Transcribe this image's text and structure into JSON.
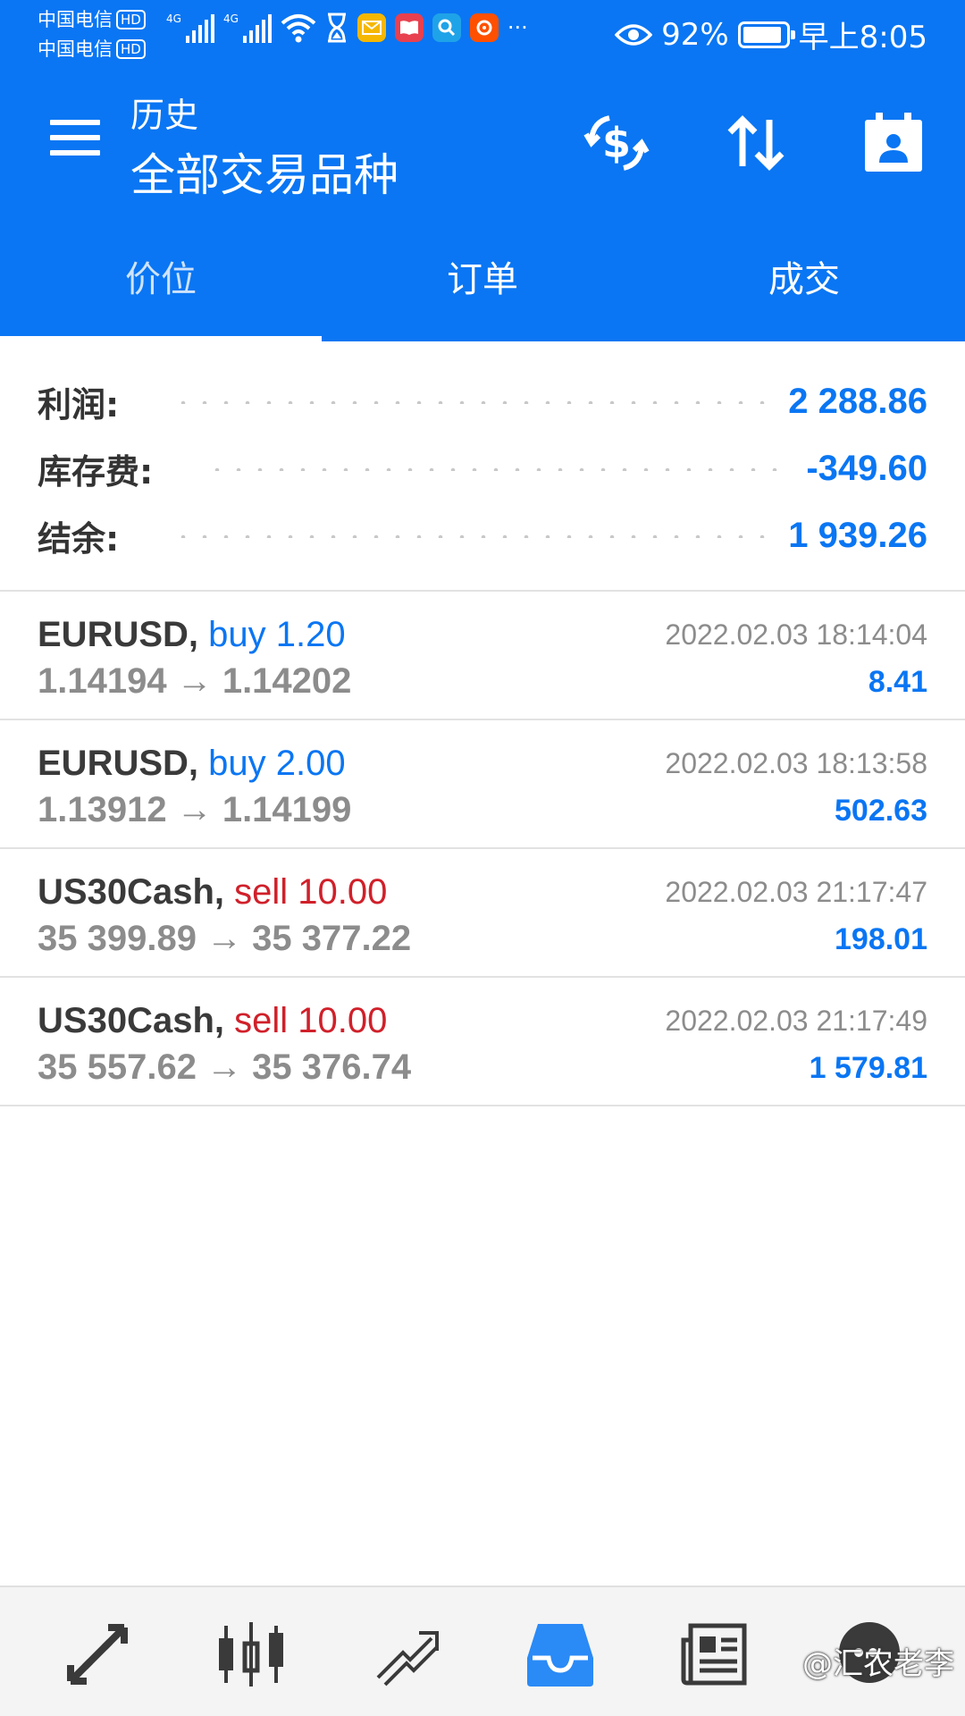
{
  "status_bar": {
    "carrier_1": "中国电信",
    "carrier_2": "中国电信",
    "hd_badge": "HD",
    "network_1": "4G",
    "network_2": "4G",
    "more": "···",
    "battery_percent": "92%",
    "battery_level": 0.92,
    "time": "早上8:05"
  },
  "toolbar": {
    "subtitle": "历史",
    "title": "全部交易品种"
  },
  "tabs": [
    {
      "label": "价位",
      "active": true
    },
    {
      "label": "订单",
      "active": false
    },
    {
      "label": "成交",
      "active": false
    }
  ],
  "summary": {
    "profit": {
      "label": "利润:",
      "value": "2 288.86"
    },
    "swap": {
      "label": "库存费:",
      "value": "-349.60"
    },
    "balance": {
      "label": "结余:",
      "value": "1 939.26"
    }
  },
  "deals": [
    {
      "symbol": "EURUSD,",
      "side": "buy",
      "side_text": "buy 1.20",
      "prices": "1.14194 → 1.14202",
      "time": "2022.02.03 18:14:04",
      "profit": "8.41"
    },
    {
      "symbol": "EURUSD,",
      "side": "buy",
      "side_text": "buy 2.00",
      "prices": "1.13912 → 1.14199",
      "time": "2022.02.03 18:13:58",
      "profit": "502.63"
    },
    {
      "symbol": "US30Cash,",
      "side": "sell",
      "side_text": "sell 10.00",
      "prices": "35 399.89 → 35 377.22",
      "time": "2022.02.03 21:17:47",
      "profit": "198.01"
    },
    {
      "symbol": "US30Cash,",
      "side": "sell",
      "side_text": "sell 10.00",
      "prices": "35 557.62 → 35 376.74",
      "time": "2022.02.03 21:17:49",
      "profit": "1 579.81"
    }
  ],
  "bottom_nav": {
    "items": [
      "quotes-icon",
      "chart-icon",
      "trade-icon",
      "history-icon",
      "news-icon",
      "chat-icon"
    ],
    "active": "history-icon"
  },
  "watermark": "@汇农老李",
  "colors": {
    "brand_blue": "#0a76f3",
    "sell_red": "#d0202a",
    "muted_gray": "#8c8c8c"
  }
}
